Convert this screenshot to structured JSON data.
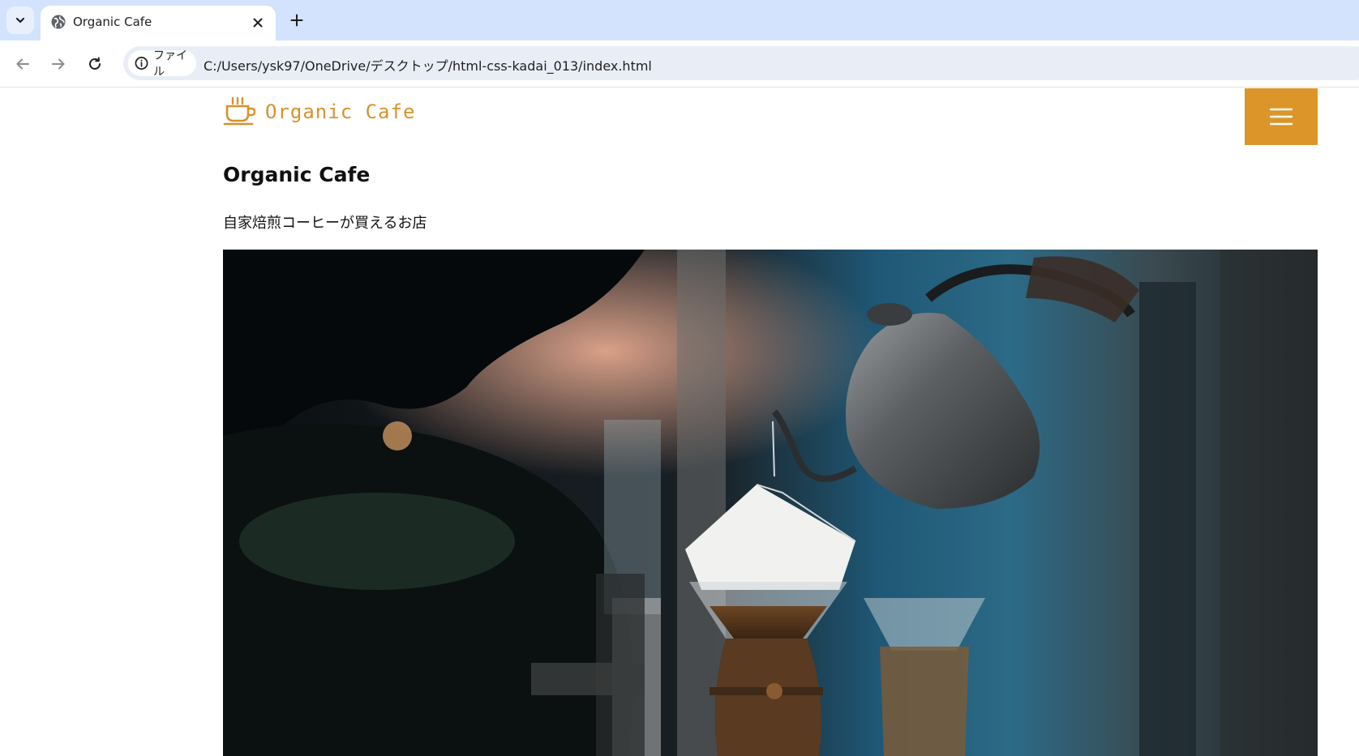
{
  "browser": {
    "tab": {
      "title": "Organic Cafe"
    },
    "address_bar": {
      "site_chip_label": "ファイル",
      "url": "C:/Users/ysk97/OneDrive/デスクトップ/html-css-kadai_013/index.html"
    },
    "icons": {
      "tab_list": "chevron-down-icon",
      "favicon": "globe-icon",
      "close": "close-icon",
      "new_tab": "plus-icon",
      "back": "arrow-left-icon",
      "forward": "arrow-right-icon",
      "reload": "reload-icon",
      "info": "info-icon"
    }
  },
  "site": {
    "logo_text": "Organic Cafe",
    "title": "Organic Cafe",
    "tagline": "自家焙煎コーヒーが買えるお店",
    "hero_description": "Barista pouring hot water from a gooseneck kettle into a glass pour-over coffee maker with a paper filter",
    "icons": {
      "logo": "coffee-cup-icon",
      "menu": "hamburger-menu-icon"
    },
    "colors": {
      "accent": "#dc9529",
      "logo_text": "#d8922c"
    }
  }
}
